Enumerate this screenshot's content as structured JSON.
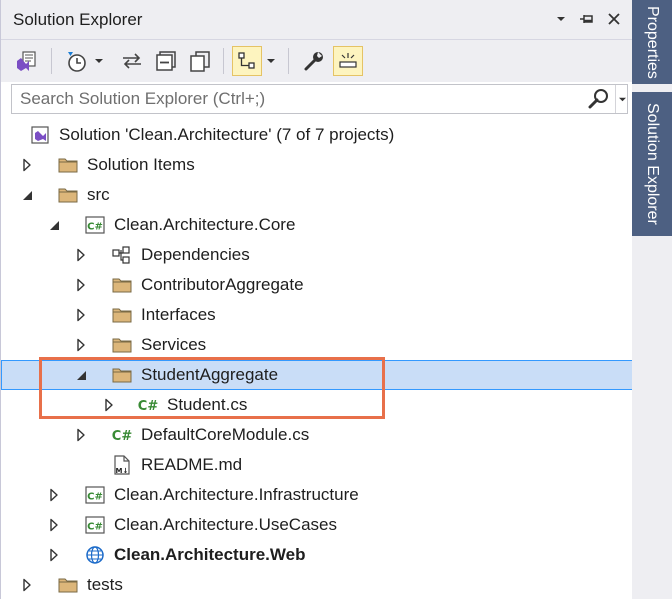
{
  "window": {
    "title": "Solution Explorer"
  },
  "search": {
    "placeholder": "Search Solution Explorer (Ctrl+;)"
  },
  "tree": [
    {
      "label": "Solution 'Clean.Architecture' (7 of 7 projects)",
      "icon": "solution-icon",
      "expander": "none",
      "level": 0
    },
    {
      "label": "Solution Items",
      "icon": "folder-icon",
      "expander": "collapsed",
      "level": 1
    },
    {
      "label": "src",
      "icon": "folder-icon",
      "expander": "expanded",
      "level": 1
    },
    {
      "label": "Clean.Architecture.Core",
      "icon": "csharp-project-icon",
      "expander": "expanded",
      "level": 2
    },
    {
      "label": "Dependencies",
      "icon": "dependencies-icon",
      "expander": "collapsed",
      "level": 3
    },
    {
      "label": "ContributorAggregate",
      "icon": "folder-icon",
      "expander": "collapsed",
      "level": 3
    },
    {
      "label": "Interfaces",
      "icon": "folder-icon",
      "expander": "collapsed",
      "level": 3
    },
    {
      "label": "Services",
      "icon": "folder-icon",
      "expander": "collapsed",
      "level": 3
    },
    {
      "label": "StudentAggregate",
      "icon": "folder-icon",
      "expander": "expanded",
      "level": 3,
      "selected": true
    },
    {
      "label": "Student.cs",
      "icon": "csharp-file-icon",
      "expander": "collapsed",
      "level": 4
    },
    {
      "label": "DefaultCoreModule.cs",
      "icon": "csharp-file-icon",
      "expander": "collapsed",
      "level": 3
    },
    {
      "label": "README.md",
      "icon": "markdown-file-icon",
      "expander": "none",
      "level": 3
    },
    {
      "label": "Clean.Architecture.Infrastructure",
      "icon": "csharp-project-icon",
      "expander": "collapsed",
      "level": 2
    },
    {
      "label": "Clean.Architecture.UseCases",
      "icon": "csharp-project-icon",
      "expander": "collapsed",
      "level": 2
    },
    {
      "label": "Clean.Architecture.Web",
      "icon": "web-project-icon",
      "expander": "collapsed",
      "level": 2,
      "bold": true
    },
    {
      "label": "tests",
      "icon": "folder-icon",
      "expander": "collapsed",
      "level": 1
    }
  ],
  "side_tabs": {
    "properties": "Properties",
    "solution_explorer": "Solution Explorer"
  },
  "colors": {
    "selection": "#c9ddf7",
    "highlight_box": "#e8704a",
    "side_tab": "#4d6082",
    "folder": "#dcb67a"
  }
}
